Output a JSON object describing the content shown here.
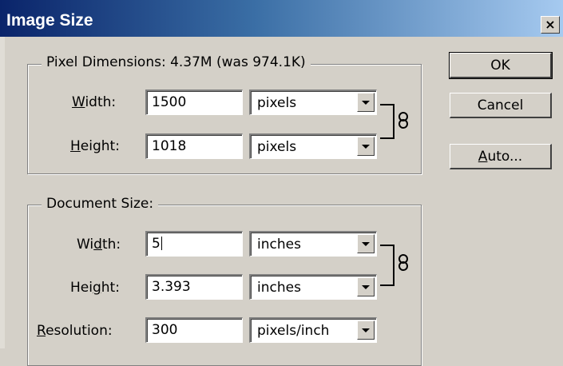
{
  "window": {
    "title": "Image Size",
    "close_glyph": "×"
  },
  "pixel_dimensions": {
    "legend": "Pixel Dimensions:  4.37M (was 974.1K)",
    "width": {
      "label_pre": "",
      "label_key": "W",
      "label_post": "idth:",
      "value": "1500",
      "unit": "pixels"
    },
    "height": {
      "label_pre": "",
      "label_key": "H",
      "label_post": "eight:",
      "value": "1018",
      "unit": "pixels"
    }
  },
  "document_size": {
    "legend": "Document Size:",
    "width": {
      "label_pre": "Wi",
      "label_key": "d",
      "label_post": "th:",
      "value": "5",
      "unit": "inches"
    },
    "height": {
      "label_pre": "Hei",
      "label_key": "g",
      "label_post": "ht:",
      "value": "3.393",
      "unit": "inches"
    },
    "resolution": {
      "label_pre": "",
      "label_key": "R",
      "label_post": "esolution:",
      "value": "300",
      "unit": "pixels/inch"
    }
  },
  "buttons": {
    "ok": "OK",
    "cancel": "Cancel",
    "auto_key": "A",
    "auto_rest": "uto..."
  },
  "icons": {
    "link": "chain-link-icon",
    "dropdown": "triangle-down"
  }
}
